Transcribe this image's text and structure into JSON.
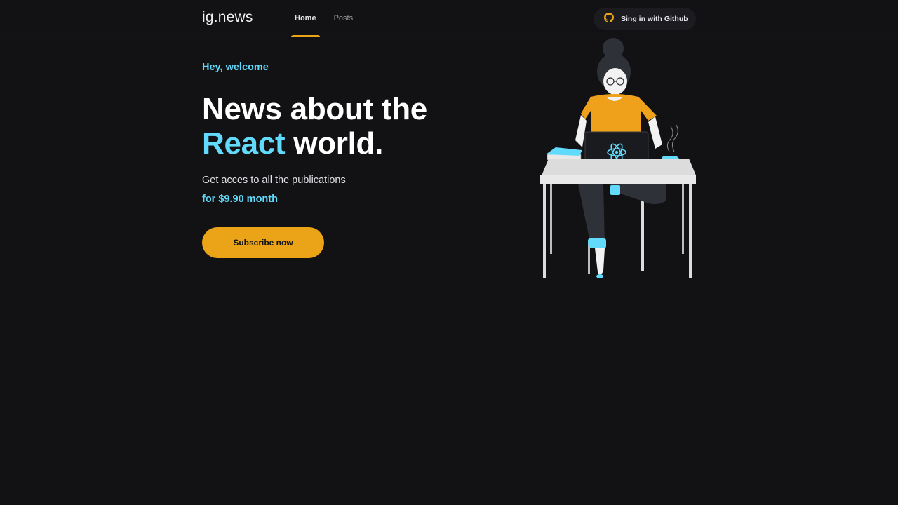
{
  "header": {
    "logo": "ig.news",
    "nav": [
      {
        "label": "Home",
        "active": true
      },
      {
        "label": "Posts",
        "active": false
      }
    ],
    "signin": {
      "label": "Sing in with Github",
      "icon": "github-icon"
    }
  },
  "hero": {
    "welcome": "Hey, welcome",
    "headline_line1": "News about the",
    "headline_accent": "React",
    "headline_rest": " world.",
    "subtitle": "Get acces to all the publications",
    "price": "for $9.90 month",
    "cta": "Subscribe now"
  },
  "colors": {
    "background": "#121214",
    "accent_yellow": "#eba417",
    "accent_cyan": "#61dafb",
    "text": "#e1e1e6"
  }
}
